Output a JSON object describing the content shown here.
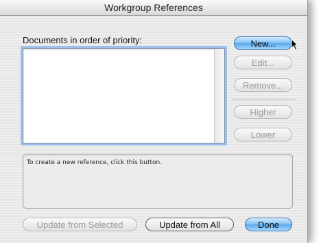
{
  "window": {
    "title": "Workgroup References"
  },
  "documents_label": "Documents in order of priority:",
  "side_buttons": {
    "new": "New...",
    "edit": "Edit...",
    "remove": "Remove...",
    "higher": "Higher",
    "lower": "Lower"
  },
  "info_text": "To create a new reference, click this button.",
  "bottom_buttons": {
    "update_selected": "Update from Selected",
    "update_all": "Update from All",
    "done": "Done"
  },
  "colors": {
    "accent_blue": "#6bb4f0",
    "focus_ring": "#9fc0e8"
  },
  "icons": {
    "pointer": "arrow-cursor-icon"
  }
}
